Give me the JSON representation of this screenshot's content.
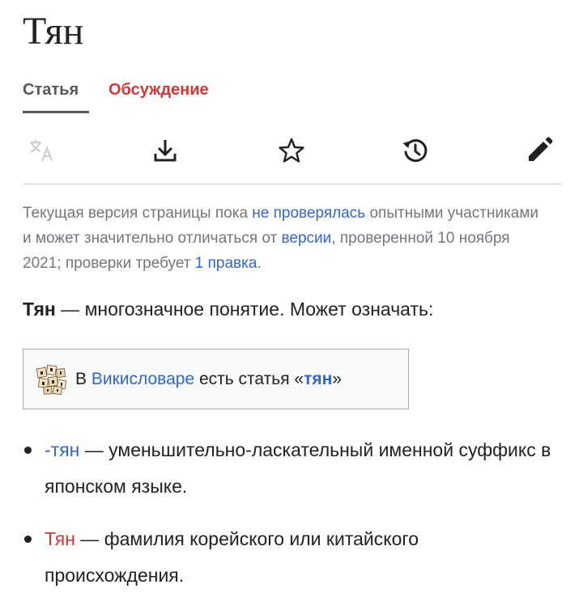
{
  "page": {
    "title": "Тян"
  },
  "tabs": [
    {
      "label": "Статья",
      "active": true
    },
    {
      "label": "Обсуждение",
      "active": false
    }
  ],
  "toolbar": {
    "icons": [
      "translate-icon",
      "download-icon",
      "star-icon",
      "history-icon",
      "edit-icon"
    ]
  },
  "notice": {
    "part1": "Текущая версия страницы пока ",
    "link1": "не проверялась",
    "part2": " опытными участниками и может значительно отличаться от ",
    "link2": "версии",
    "part3": ", проверенной 10 ноября 2021; проверки требует ",
    "link3": "1 правка",
    "part4": "."
  },
  "intro": {
    "bold": "Тян",
    "rest": " — многозначное понятие. Может означать:"
  },
  "wiktionary": {
    "prefix": "В ",
    "link": "Викисловаре",
    "middle": " есть статья «",
    "term": "тян",
    "suffix": "»"
  },
  "list": [
    {
      "link": "-тян",
      "link_color": "blue",
      "text": " — уменьшительно-ласкательный именной суффикс в японском языке."
    },
    {
      "link": "Тян",
      "link_color": "red",
      "text": " — фамилия корейского или китайского происхождения."
    }
  ],
  "colors": {
    "link_blue": "#3366cc",
    "link_red": "#d33636",
    "text": "#202122",
    "muted": "#72777d"
  }
}
